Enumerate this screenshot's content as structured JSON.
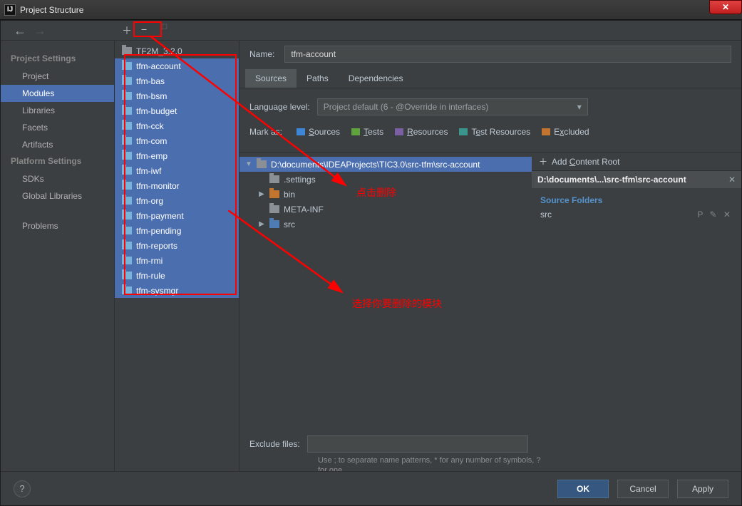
{
  "window": {
    "title": "Project Structure"
  },
  "nav": {
    "heading1": "Project Settings",
    "items1": [
      "Project",
      "Modules",
      "Libraries",
      "Facets",
      "Artifacts"
    ],
    "active1": 1,
    "heading2": "Platform Settings",
    "items2": [
      "SDKs",
      "Global Libraries"
    ],
    "problems": "Problems"
  },
  "modules": {
    "top": "TF2M_3.2.0",
    "list": [
      "tfm-account",
      "tfm-bas",
      "tfm-bsm",
      "tfm-budget",
      "tfm-cck",
      "tfm-com",
      "tfm-emp",
      "tfm-iwf",
      "tfm-monitor",
      "tfm-org",
      "tfm-payment",
      "tfm-pending",
      "tfm-reports",
      "tfm-rmi",
      "tfm-rule",
      "tfm-sysmgr"
    ]
  },
  "detail": {
    "name_label": "Name:",
    "name_value": "tfm-account",
    "tabs": [
      "Sources",
      "Paths",
      "Dependencies"
    ],
    "lang_label": "Language level:",
    "lang_value": "Project default (6 - @Override in interfaces)",
    "mark_label": "Mark as:",
    "marks": {
      "sources": "Sources",
      "tests": "Tests",
      "resources": "Resources",
      "testres": "Test Resources",
      "excluded": "Excluded"
    },
    "root_path": "D:\\documents\\IDEAProjects\\TIC3.0\\src-tfm\\src-account",
    "tree": [
      ".settings",
      "bin",
      "META-INF",
      "src"
    ],
    "add_root": "Add Content Root",
    "side_path": "D:\\documents\\...\\src-tfm\\src-account",
    "source_folders_label": "Source Folders",
    "source_folders": [
      "src"
    ],
    "exclude_label": "Exclude files:",
    "exclude_help": "Use ; to separate name patterns, * for any number of symbols, ? for one."
  },
  "buttons": {
    "ok": "OK",
    "cancel": "Cancel",
    "apply": "Apply"
  },
  "annotations": {
    "a1": "点击删除",
    "a2": "选择你要删除的模块"
  }
}
